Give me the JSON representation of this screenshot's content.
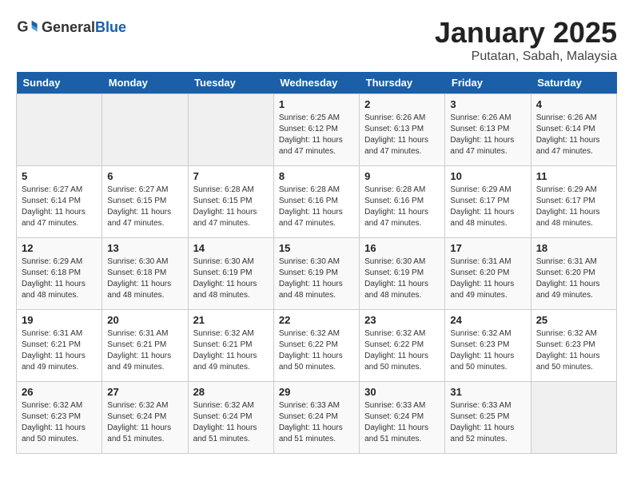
{
  "header": {
    "logo_general": "General",
    "logo_blue": "Blue",
    "month": "January 2025",
    "location": "Putatan, Sabah, Malaysia"
  },
  "days_of_week": [
    "Sunday",
    "Monday",
    "Tuesday",
    "Wednesday",
    "Thursday",
    "Friday",
    "Saturday"
  ],
  "weeks": [
    [
      {
        "day": "",
        "info": ""
      },
      {
        "day": "",
        "info": ""
      },
      {
        "day": "",
        "info": ""
      },
      {
        "day": "1",
        "info": "Sunrise: 6:25 AM\nSunset: 6:12 PM\nDaylight: 11 hours\nand 47 minutes."
      },
      {
        "day": "2",
        "info": "Sunrise: 6:26 AM\nSunset: 6:13 PM\nDaylight: 11 hours\nand 47 minutes."
      },
      {
        "day": "3",
        "info": "Sunrise: 6:26 AM\nSunset: 6:13 PM\nDaylight: 11 hours\nand 47 minutes."
      },
      {
        "day": "4",
        "info": "Sunrise: 6:26 AM\nSunset: 6:14 PM\nDaylight: 11 hours\nand 47 minutes."
      }
    ],
    [
      {
        "day": "5",
        "info": "Sunrise: 6:27 AM\nSunset: 6:14 PM\nDaylight: 11 hours\nand 47 minutes."
      },
      {
        "day": "6",
        "info": "Sunrise: 6:27 AM\nSunset: 6:15 PM\nDaylight: 11 hours\nand 47 minutes."
      },
      {
        "day": "7",
        "info": "Sunrise: 6:28 AM\nSunset: 6:15 PM\nDaylight: 11 hours\nand 47 minutes."
      },
      {
        "day": "8",
        "info": "Sunrise: 6:28 AM\nSunset: 6:16 PM\nDaylight: 11 hours\nand 47 minutes."
      },
      {
        "day": "9",
        "info": "Sunrise: 6:28 AM\nSunset: 6:16 PM\nDaylight: 11 hours\nand 47 minutes."
      },
      {
        "day": "10",
        "info": "Sunrise: 6:29 AM\nSunset: 6:17 PM\nDaylight: 11 hours\nand 48 minutes."
      },
      {
        "day": "11",
        "info": "Sunrise: 6:29 AM\nSunset: 6:17 PM\nDaylight: 11 hours\nand 48 minutes."
      }
    ],
    [
      {
        "day": "12",
        "info": "Sunrise: 6:29 AM\nSunset: 6:18 PM\nDaylight: 11 hours\nand 48 minutes."
      },
      {
        "day": "13",
        "info": "Sunrise: 6:30 AM\nSunset: 6:18 PM\nDaylight: 11 hours\nand 48 minutes."
      },
      {
        "day": "14",
        "info": "Sunrise: 6:30 AM\nSunset: 6:19 PM\nDaylight: 11 hours\nand 48 minutes."
      },
      {
        "day": "15",
        "info": "Sunrise: 6:30 AM\nSunset: 6:19 PM\nDaylight: 11 hours\nand 48 minutes."
      },
      {
        "day": "16",
        "info": "Sunrise: 6:30 AM\nSunset: 6:19 PM\nDaylight: 11 hours\nand 48 minutes."
      },
      {
        "day": "17",
        "info": "Sunrise: 6:31 AM\nSunset: 6:20 PM\nDaylight: 11 hours\nand 49 minutes."
      },
      {
        "day": "18",
        "info": "Sunrise: 6:31 AM\nSunset: 6:20 PM\nDaylight: 11 hours\nand 49 minutes."
      }
    ],
    [
      {
        "day": "19",
        "info": "Sunrise: 6:31 AM\nSunset: 6:21 PM\nDaylight: 11 hours\nand 49 minutes."
      },
      {
        "day": "20",
        "info": "Sunrise: 6:31 AM\nSunset: 6:21 PM\nDaylight: 11 hours\nand 49 minutes."
      },
      {
        "day": "21",
        "info": "Sunrise: 6:32 AM\nSunset: 6:21 PM\nDaylight: 11 hours\nand 49 minutes."
      },
      {
        "day": "22",
        "info": "Sunrise: 6:32 AM\nSunset: 6:22 PM\nDaylight: 11 hours\nand 50 minutes."
      },
      {
        "day": "23",
        "info": "Sunrise: 6:32 AM\nSunset: 6:22 PM\nDaylight: 11 hours\nand 50 minutes."
      },
      {
        "day": "24",
        "info": "Sunrise: 6:32 AM\nSunset: 6:23 PM\nDaylight: 11 hours\nand 50 minutes."
      },
      {
        "day": "25",
        "info": "Sunrise: 6:32 AM\nSunset: 6:23 PM\nDaylight: 11 hours\nand 50 minutes."
      }
    ],
    [
      {
        "day": "26",
        "info": "Sunrise: 6:32 AM\nSunset: 6:23 PM\nDaylight: 11 hours\nand 50 minutes."
      },
      {
        "day": "27",
        "info": "Sunrise: 6:32 AM\nSunset: 6:24 PM\nDaylight: 11 hours\nand 51 minutes."
      },
      {
        "day": "28",
        "info": "Sunrise: 6:32 AM\nSunset: 6:24 PM\nDaylight: 11 hours\nand 51 minutes."
      },
      {
        "day": "29",
        "info": "Sunrise: 6:33 AM\nSunset: 6:24 PM\nDaylight: 11 hours\nand 51 minutes."
      },
      {
        "day": "30",
        "info": "Sunrise: 6:33 AM\nSunset: 6:24 PM\nDaylight: 11 hours\nand 51 minutes."
      },
      {
        "day": "31",
        "info": "Sunrise: 6:33 AM\nSunset: 6:25 PM\nDaylight: 11 hours\nand 52 minutes."
      },
      {
        "day": "",
        "info": ""
      }
    ]
  ]
}
